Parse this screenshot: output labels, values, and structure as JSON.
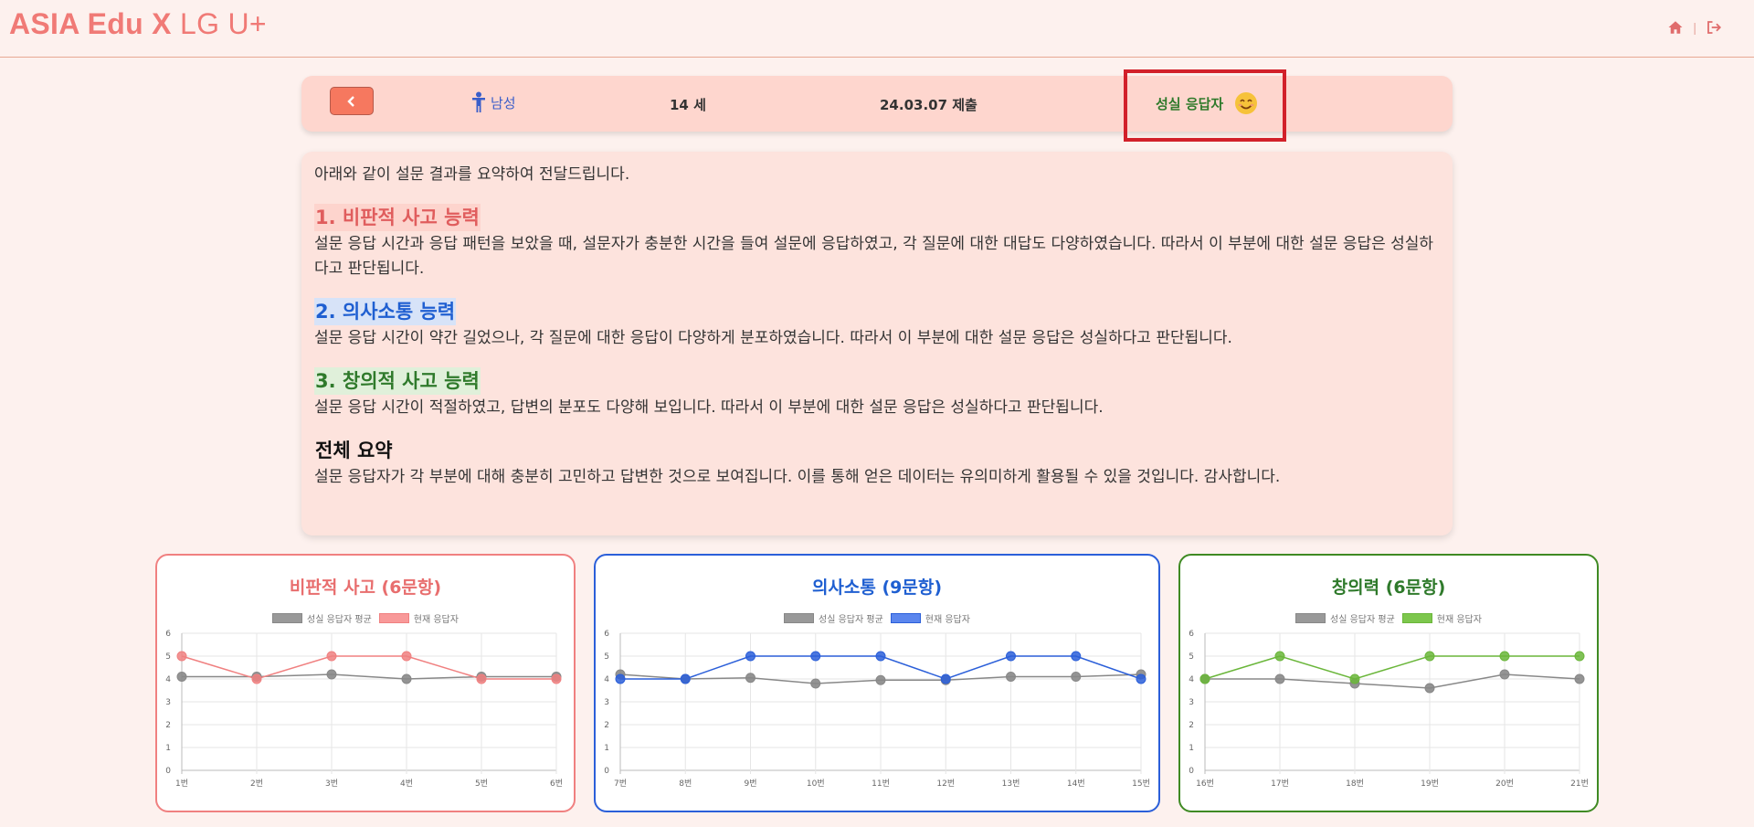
{
  "header": {
    "brand_bold": "ASIA Edu X",
    "brand_light": " LG U+",
    "separator": "|",
    "icons": [
      "home-icon",
      "logout-icon"
    ]
  },
  "infobar": {
    "back_icon": "chevron-left-icon",
    "gender_icon": "person-icon",
    "gender": "남성",
    "age": "14 세",
    "submitted": "24.03.07 제출",
    "status": "성실 응답자",
    "status_icon": "smiley-icon"
  },
  "summary": {
    "intro": "아래와 같이 설문 결과를 요약하여 전달드립니다.",
    "sections": [
      {
        "title": "1. 비판적 사고 능력",
        "body": "설문 응답 시간과 응답 패턴을 보았을 때, 설문자가 충분한 시간을 들여 설문에 응답하였고, 각 질문에 대한 대답도 다양하였습니다. 따라서 이 부분에 대한 설문 응답은 성실하다고 판단됩니다."
      },
      {
        "title": "2. 의사소통 능력",
        "body": "설문 응답 시간이 약간 길었으나, 각 질문에 대한 응답이 다양하게 분포하였습니다. 따라서 이 부분에 대한 설문 응답은 성실하다고 판단됩니다."
      },
      {
        "title": "3. 창의적 사고 능력",
        "body": "설문 응답 시간이 적절하였고, 답변의 분포도 다양해 보입니다. 따라서 이 부분에 대한 설문 응답은 성실하다고 판단됩니다."
      },
      {
        "title": "전체 요약",
        "body": "설문 응답자가 각 부분에 대해 충분히 고민하고 답변한 것으로 보여집니다. 이를 통해 얻은 데이터는 유의미하게 활용될 수 있을 것입니다. 감사합니다."
      }
    ]
  },
  "colors": {
    "critical": "#f08080",
    "communication": "#2b5fd9",
    "creativity": "#6ab63a",
    "average": "#888888"
  },
  "chart_data": [
    {
      "type": "line",
      "title": "비판적 사고 (6문항)",
      "categories": [
        "1번",
        "2번",
        "3번",
        "4번",
        "5번",
        "6번"
      ],
      "ylim": [
        0,
        6
      ],
      "yticks": [
        "0",
        "1",
        "2",
        "3",
        "4",
        "5",
        "6"
      ],
      "series": [
        {
          "name": "성실 응답자 평균",
          "values": [
            4.1,
            4.1,
            4.2,
            4.0,
            4.1,
            4.1
          ]
        },
        {
          "name": "현재 응답자",
          "values": [
            5,
            4,
            5,
            5,
            4,
            4
          ]
        }
      ]
    },
    {
      "type": "line",
      "title": "의사소통 (9문항)",
      "categories": [
        "7번",
        "8번",
        "9번",
        "10번",
        "11번",
        "12번",
        "13번",
        "14번",
        "15번"
      ],
      "ylim": [
        0,
        6
      ],
      "yticks": [
        "0",
        "1",
        "2",
        "3",
        "4",
        "5",
        "6"
      ],
      "series": [
        {
          "name": "성실 응답자 평균",
          "values": [
            4.2,
            4.0,
            4.05,
            3.8,
            3.95,
            3.95,
            4.1,
            4.1,
            4.2
          ]
        },
        {
          "name": "현재 응답자",
          "values": [
            4,
            4,
            5,
            5,
            5,
            4,
            5,
            5,
            4
          ]
        }
      ]
    },
    {
      "type": "line",
      "title": "창의력 (6문항)",
      "categories": [
        "16번",
        "17번",
        "18번",
        "19번",
        "20번",
        "21번"
      ],
      "ylim": [
        0,
        6
      ],
      "yticks": [
        "0",
        "1",
        "2",
        "3",
        "4",
        "5",
        "6"
      ],
      "series": [
        {
          "name": "성실 응답자 평균",
          "values": [
            4.0,
            4.0,
            3.8,
            3.6,
            4.2,
            4.0
          ]
        },
        {
          "name": "현재 응답자",
          "values": [
            4,
            5,
            4,
            5,
            5,
            5
          ]
        }
      ]
    }
  ]
}
